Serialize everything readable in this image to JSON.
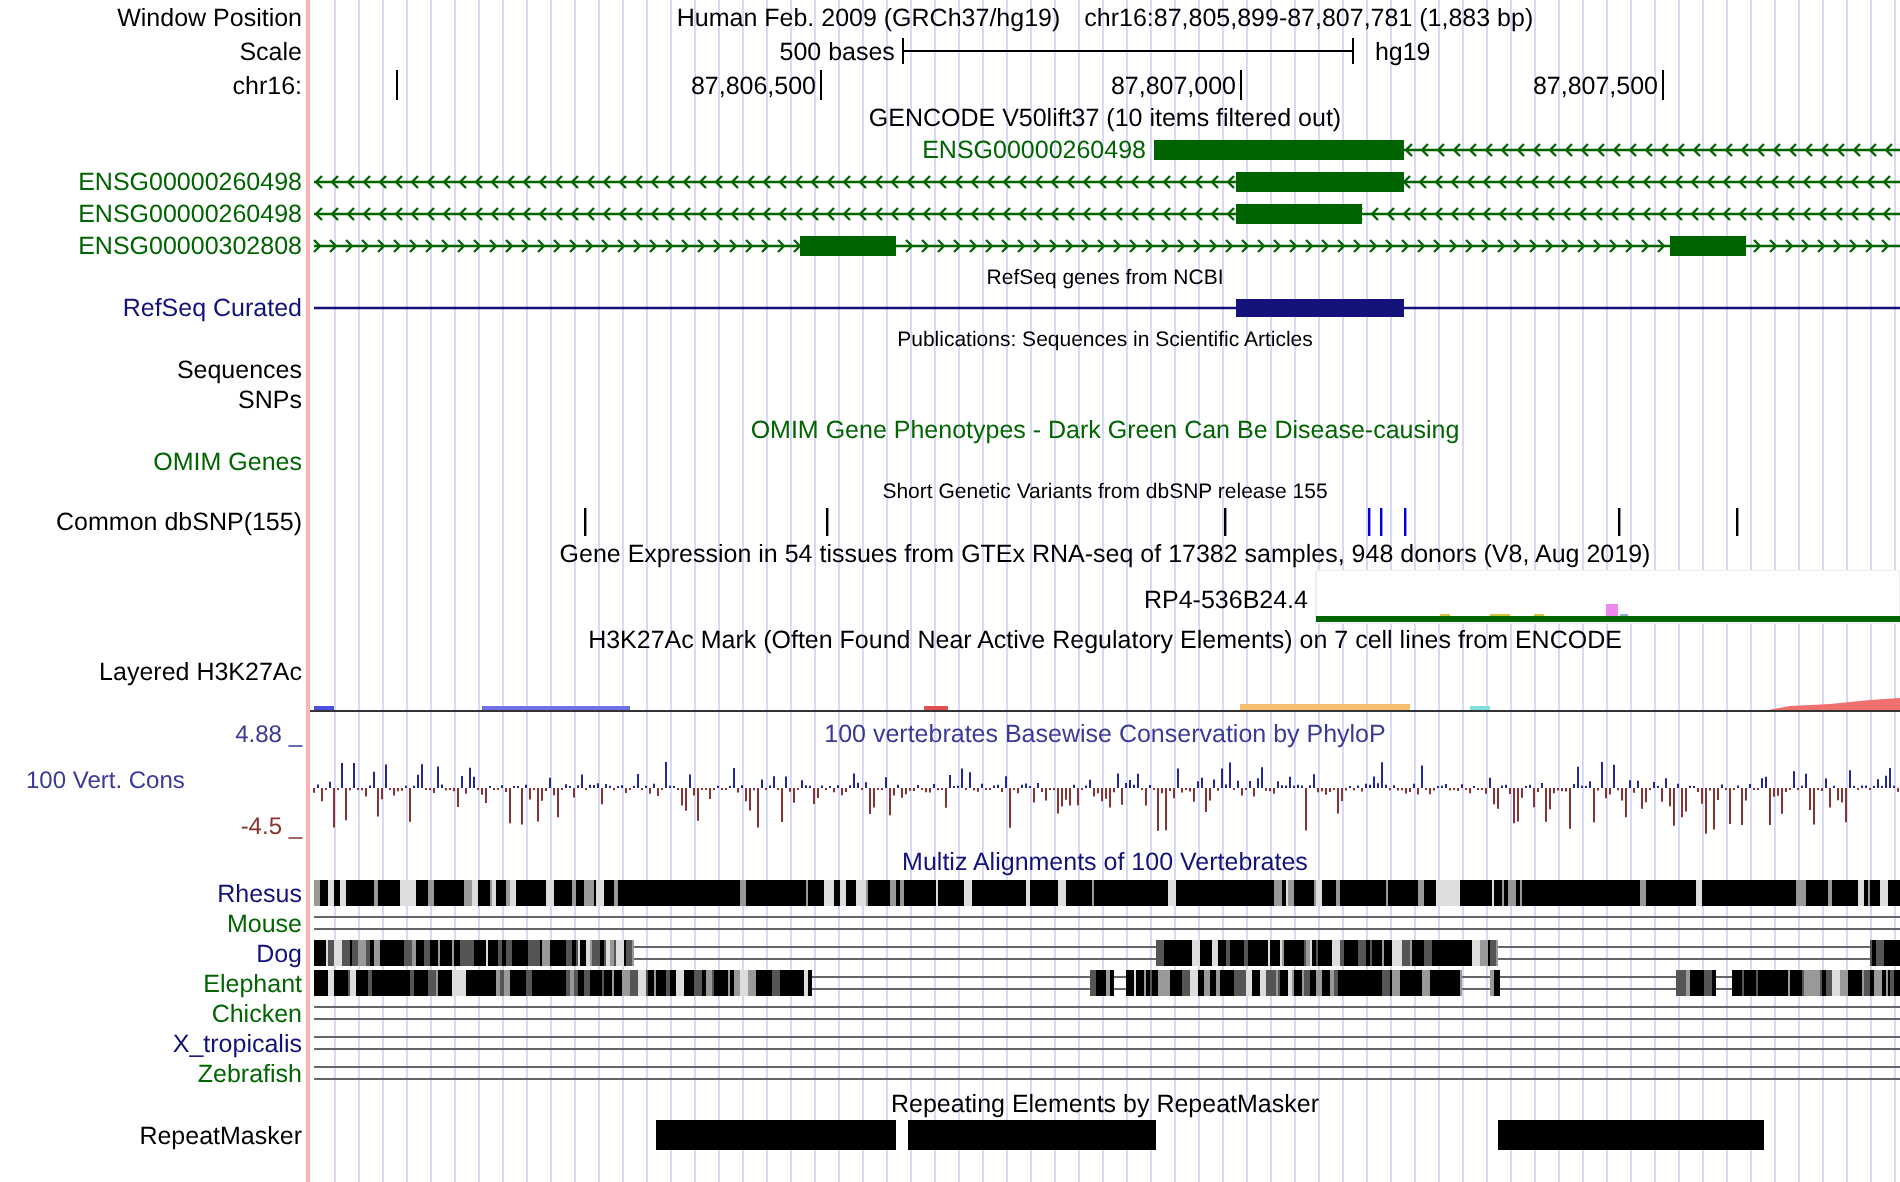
{
  "header": {
    "window_position_label": "Window Position",
    "assembly": "Human Feb. 2009 (GRCh37/hg19)",
    "position": "chr16:87,805,899-87,807,781 (1,883 bp)",
    "scale_label": "Scale",
    "scale_length": "500 bases",
    "scale_assembly": "hg19",
    "chrom_label": "chr16:",
    "ruler_ticks": [
      "87,806,500",
      "87,807,000",
      "87,807,500"
    ]
  },
  "tracks": [
    {
      "kind": "title",
      "text": "GENCODE V50lift37 (10 items filtered out)",
      "color": "#000000"
    },
    {
      "kind": "gene",
      "inline_label": "ENSG00000260498",
      "reverse": true,
      "color": "#006400"
    },
    {
      "kind": "gene",
      "label": "ENSG00000260498",
      "reverse": true,
      "color": "#006400"
    },
    {
      "kind": "gene",
      "label": "ENSG00000260498",
      "reverse": true,
      "color": "#006400"
    },
    {
      "kind": "gene",
      "label": "ENSG00000302808",
      "reverse": false,
      "color": "#006400"
    },
    {
      "kind": "subtitle",
      "text": "RefSeq genes from NCBI",
      "color": "#000000"
    },
    {
      "kind": "gene",
      "label": "RefSeq Curated",
      "color": "#12127a"
    },
    {
      "kind": "subtitle",
      "text": "Publications: Sequences in Scientific Articles",
      "color": "#000000"
    },
    {
      "kind": "label",
      "label": "Sequences",
      "color": "#000000"
    },
    {
      "kind": "label",
      "label": "SNPs",
      "color": "#000000"
    },
    {
      "kind": "title",
      "text": "OMIM Gene Phenotypes - Dark Green Can Be Disease-causing",
      "color": "#006400"
    },
    {
      "kind": "label",
      "label": "OMIM Genes",
      "color": "#006400"
    },
    {
      "kind": "subtitle",
      "text": "Short Genetic Variants from dbSNP release 155",
      "color": "#000000"
    },
    {
      "kind": "snp",
      "label": "Common dbSNP(155)",
      "color": "#000000"
    },
    {
      "kind": "title",
      "text": "Gene Expression in 54 tissues from GTEx RNA-seq of 17382 samples, 948 donors (V8, Aug 2019)",
      "color": "#000000"
    },
    {
      "kind": "expression",
      "inline_label": "RP4-536B24.4"
    },
    {
      "kind": "title",
      "text": "H3K27Ac Mark (Often Found Near Active Regulatory Elements) on 7 cell lines from ENCODE",
      "color": "#000000"
    },
    {
      "kind": "signal",
      "label": "Layered H3K27Ac",
      "color": "#000000"
    },
    {
      "kind": "wiggle",
      "title": "100 vertebrates Basewise Conservation by PhyloP",
      "label": "100 Vert. Cons",
      "max_label": "4.88 _",
      "min_label": "-4.5 _",
      "color": "#3a3a96"
    },
    {
      "kind": "title",
      "text": "Multiz Alignments of 100 Vertebrates",
      "color": "#12127a"
    },
    {
      "kind": "alignment",
      "label": "Rhesus",
      "color": "#12127a"
    },
    {
      "kind": "alignment",
      "label": "Mouse",
      "color": "#006400"
    },
    {
      "kind": "alignment",
      "label": "Dog",
      "color": "#12127a"
    },
    {
      "kind": "alignment",
      "label": "Elephant",
      "color": "#006400"
    },
    {
      "kind": "alignment",
      "label": "Chicken",
      "color": "#006400"
    },
    {
      "kind": "alignment",
      "label": "X_tropicalis",
      "color": "#12127a"
    },
    {
      "kind": "alignment",
      "label": "Zebrafish",
      "color": "#006400"
    },
    {
      "kind": "title",
      "text": "Repeating Elements by RepeatMasker",
      "color": "#000000"
    },
    {
      "kind": "repeat",
      "label": "RepeatMasker",
      "color": "#000000"
    }
  ]
}
